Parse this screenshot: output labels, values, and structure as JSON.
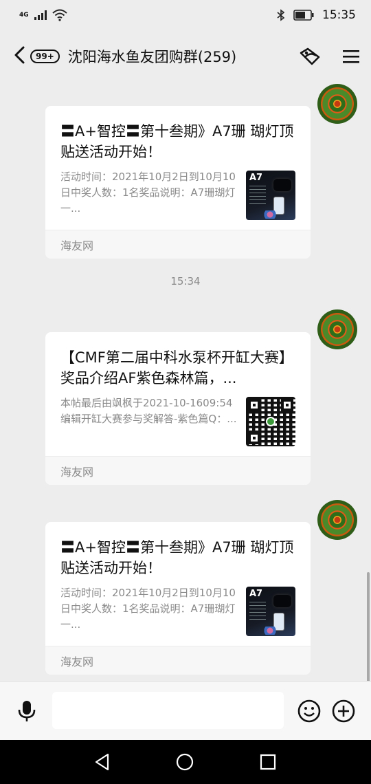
{
  "status_bar": {
    "network": "4G",
    "time": "15:35"
  },
  "header": {
    "back_icon": "chevron-left-icon",
    "unread_badge": "99+",
    "title": "沈阳海水鱼友团购群(259)",
    "right_icons": [
      "forward-link-icon",
      "menu-icon"
    ]
  },
  "messages": [
    {
      "title": "〓A+智控〓第十叁期》A7珊 瑚灯顶贴送活动开始！",
      "desc": "活动时间：2021年10月2日到10月10日中奖人数：1名奖品说明：A7珊瑚灯一...",
      "thumb_label": "A7",
      "source": "海友网"
    },
    {
      "title": "【CMF第二届中科水泵杯开缸大赛】奖品介绍AF紫色森林篇，...",
      "desc": "本帖最后由飒枫于2021-10-1609:54编辑开缸大赛参与奖解答-紫色篇Q：...",
      "source": "海友网"
    },
    {
      "title": "〓A+智控〓第十叁期》A7珊 瑚灯顶贴送活动开始！",
      "desc": "活动时间：2021年10月2日到10月10日中奖人数：1名奖品说明：A7珊瑚灯一...",
      "thumb_label": "A7",
      "source": "海友网"
    }
  ],
  "timestamp": "15:34",
  "input_bar": {
    "placeholder": "",
    "icons": [
      "microphone-icon",
      "emoji-icon",
      "plus-circle-icon"
    ]
  },
  "nav_bar": {
    "icons": [
      "back-triangle-icon",
      "home-circle-icon",
      "recents-square-icon"
    ]
  }
}
